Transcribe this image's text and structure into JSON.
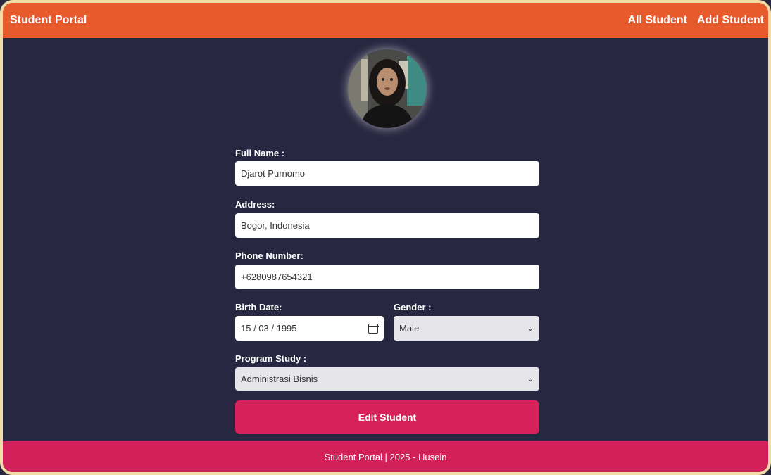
{
  "navbar": {
    "brand": "Student Portal",
    "links": [
      "All Student",
      "Add Student"
    ]
  },
  "form": {
    "full_name": {
      "label": "Full Name :",
      "value": "Djarot Purnomo"
    },
    "address": {
      "label": "Address:",
      "value": "Bogor, Indonesia"
    },
    "phone": {
      "label": "Phone Number:",
      "value": "+6280987654321"
    },
    "birth_date": {
      "label": "Birth Date:",
      "value": "15 / 03 / 1995"
    },
    "gender": {
      "label": "Gender :",
      "value": "Male"
    },
    "program": {
      "label": "Program Study :",
      "value": "Administrasi Bisnis"
    },
    "submit_label": "Edit Student"
  },
  "footer": {
    "text": "Student Portal | 2025 - Husein"
  },
  "colors": {
    "navbar": "#e75a2c",
    "background": "#282741",
    "button": "#d7215b",
    "footer": "#d2215a",
    "frame_border": "#f2dca6"
  }
}
